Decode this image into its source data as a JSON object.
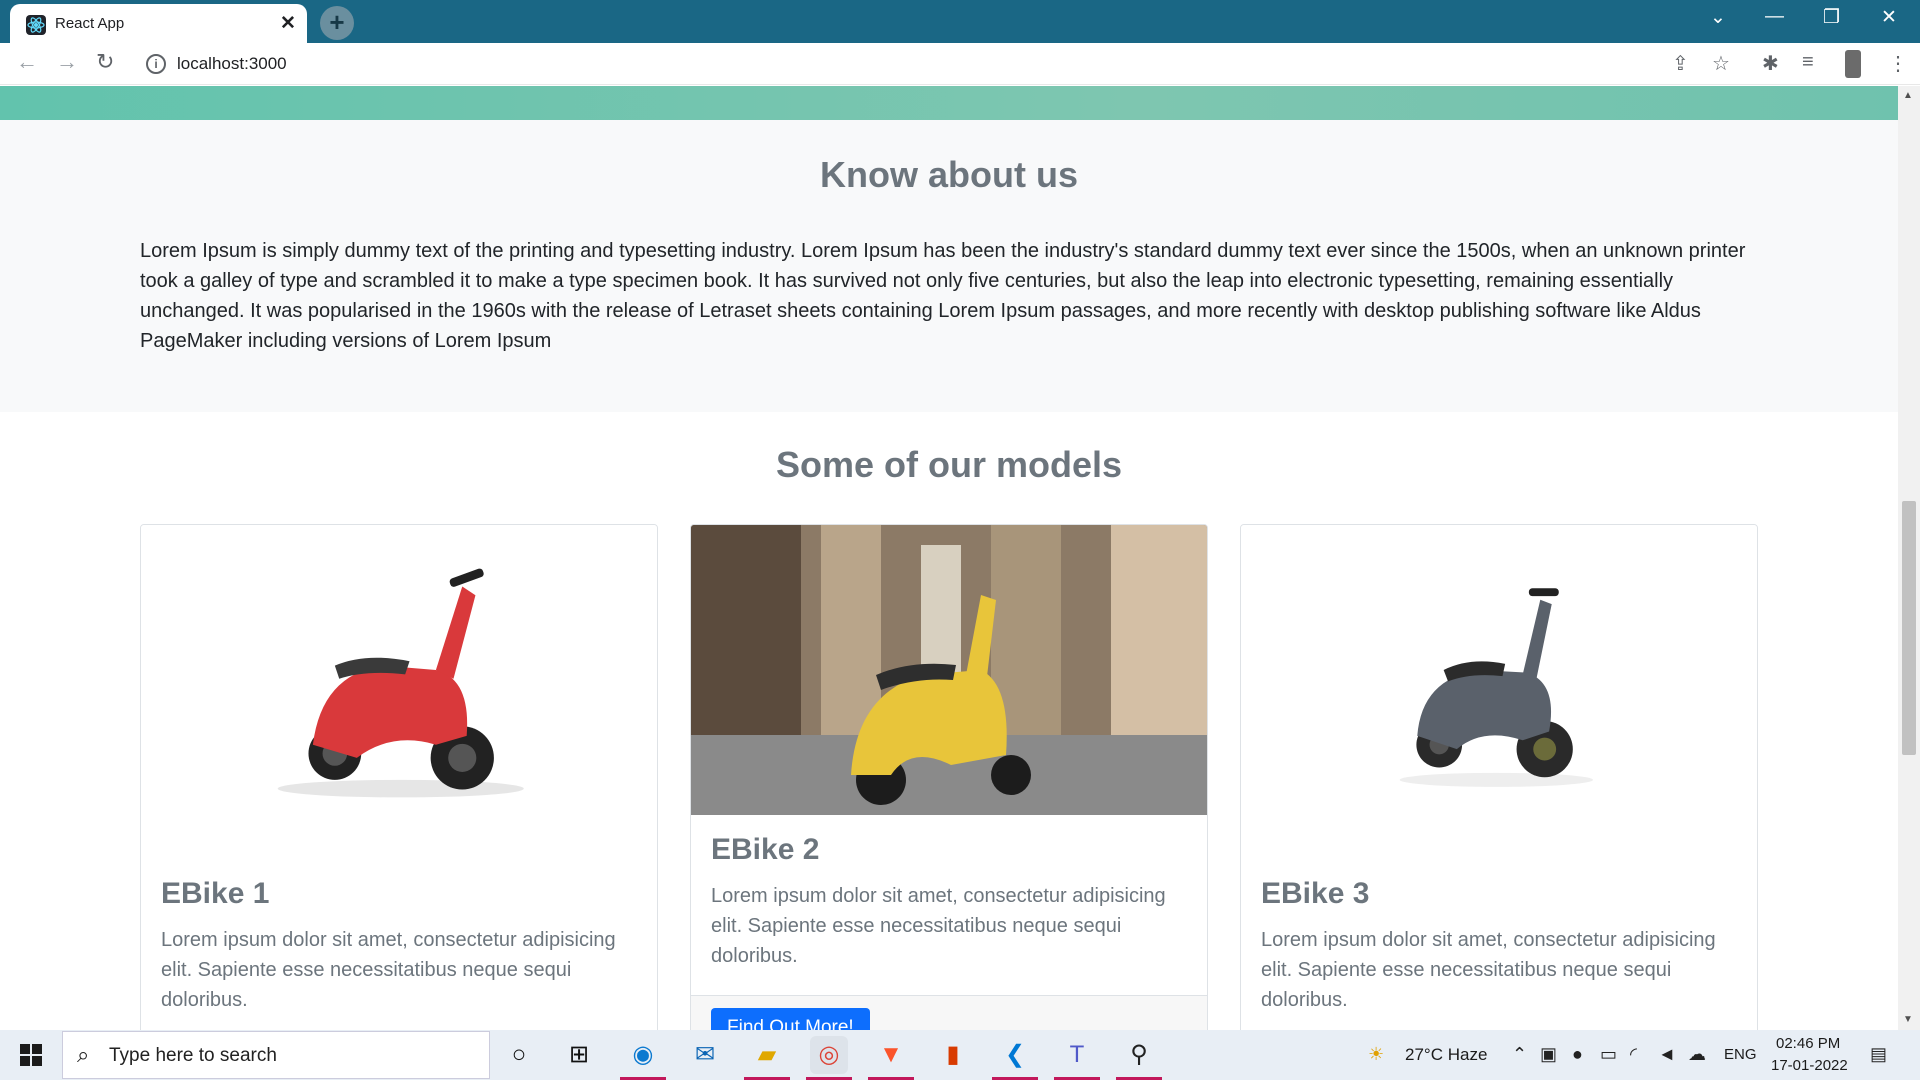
{
  "browser": {
    "tab_title": "React App",
    "tab_close": "✕",
    "new_tab": "+",
    "url": "localhost:3000",
    "window_controls": {
      "dropdown": "⌄",
      "minimize": "—",
      "restore": "❐",
      "close": "✕"
    },
    "icons": [
      "back-icon",
      "forward-icon",
      "reload-icon",
      "site-info-icon",
      "share-icon",
      "star-icon",
      "extensions-icon",
      "reading-list-icon",
      "profile-avatar",
      "menu-icon"
    ]
  },
  "page": {
    "about_title": "Know about us",
    "about_text": "Lorem Ipsum is simply dummy text of the printing and typesetting industry. Lorem Ipsum has been the industry's standard dummy text ever since the 1500s, when an unknown printer took a galley of type and scrambled it to make a type specimen book. It has survived not only five centuries, but also the leap into electronic typesetting, remaining essentially unchanged. It was popularised in the 1960s with the release of Letraset sheets containing Lorem Ipsum passages, and more recently with desktop publishing software like Aldus PageMaker including versions of Lorem Ipsum",
    "models_title": "Some of our models",
    "cards": [
      {
        "title": "EBike 1",
        "text": "Lorem ipsum dolor sit amet, consectetur adipisicing elit. Sapiente esse necessitatibus neque sequi doloribus.",
        "color": "#d9393b"
      },
      {
        "title": "EBike 2",
        "text": "Lorem ipsum dolor sit amet, consectetur adipisicing elit. Sapiente esse necessitatibus neque sequi doloribus.",
        "button": "Find Out More!",
        "color": "#e8c53a"
      },
      {
        "title": "EBike 3",
        "text": "Lorem ipsum dolor sit amet, consectetur adipisicing elit. Sapiente esse necessitatibus neque sequi doloribus.",
        "color": "#5a616b"
      }
    ]
  },
  "taskbar": {
    "search_placeholder": "Type here to search",
    "weather": "27°C  Haze",
    "language": "ENG",
    "time": "02:46 PM",
    "date": "17-01-2022"
  },
  "colors": {
    "accent": "#0d6efd",
    "tabbar": "#1a6785",
    "hero": "#6fc2ae"
  }
}
